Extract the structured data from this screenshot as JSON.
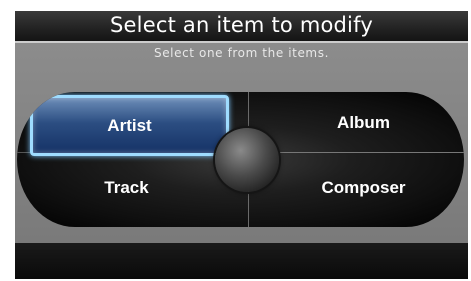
{
  "header": {
    "title": "Select an item to modify"
  },
  "main": {
    "subtitle": "Select one from the items.",
    "items": [
      {
        "label": "Artist",
        "selected": true
      },
      {
        "label": "Album",
        "selected": false
      },
      {
        "label": "Track",
        "selected": false
      },
      {
        "label": "Composer",
        "selected": false
      }
    ]
  },
  "colors": {
    "selection_fill": "#2c4e82",
    "selection_border": "#9fdcff",
    "header_bg": "#222222",
    "body_bg": "#808080"
  },
  "icons": {
    "center": "rotary-knob-icon"
  }
}
